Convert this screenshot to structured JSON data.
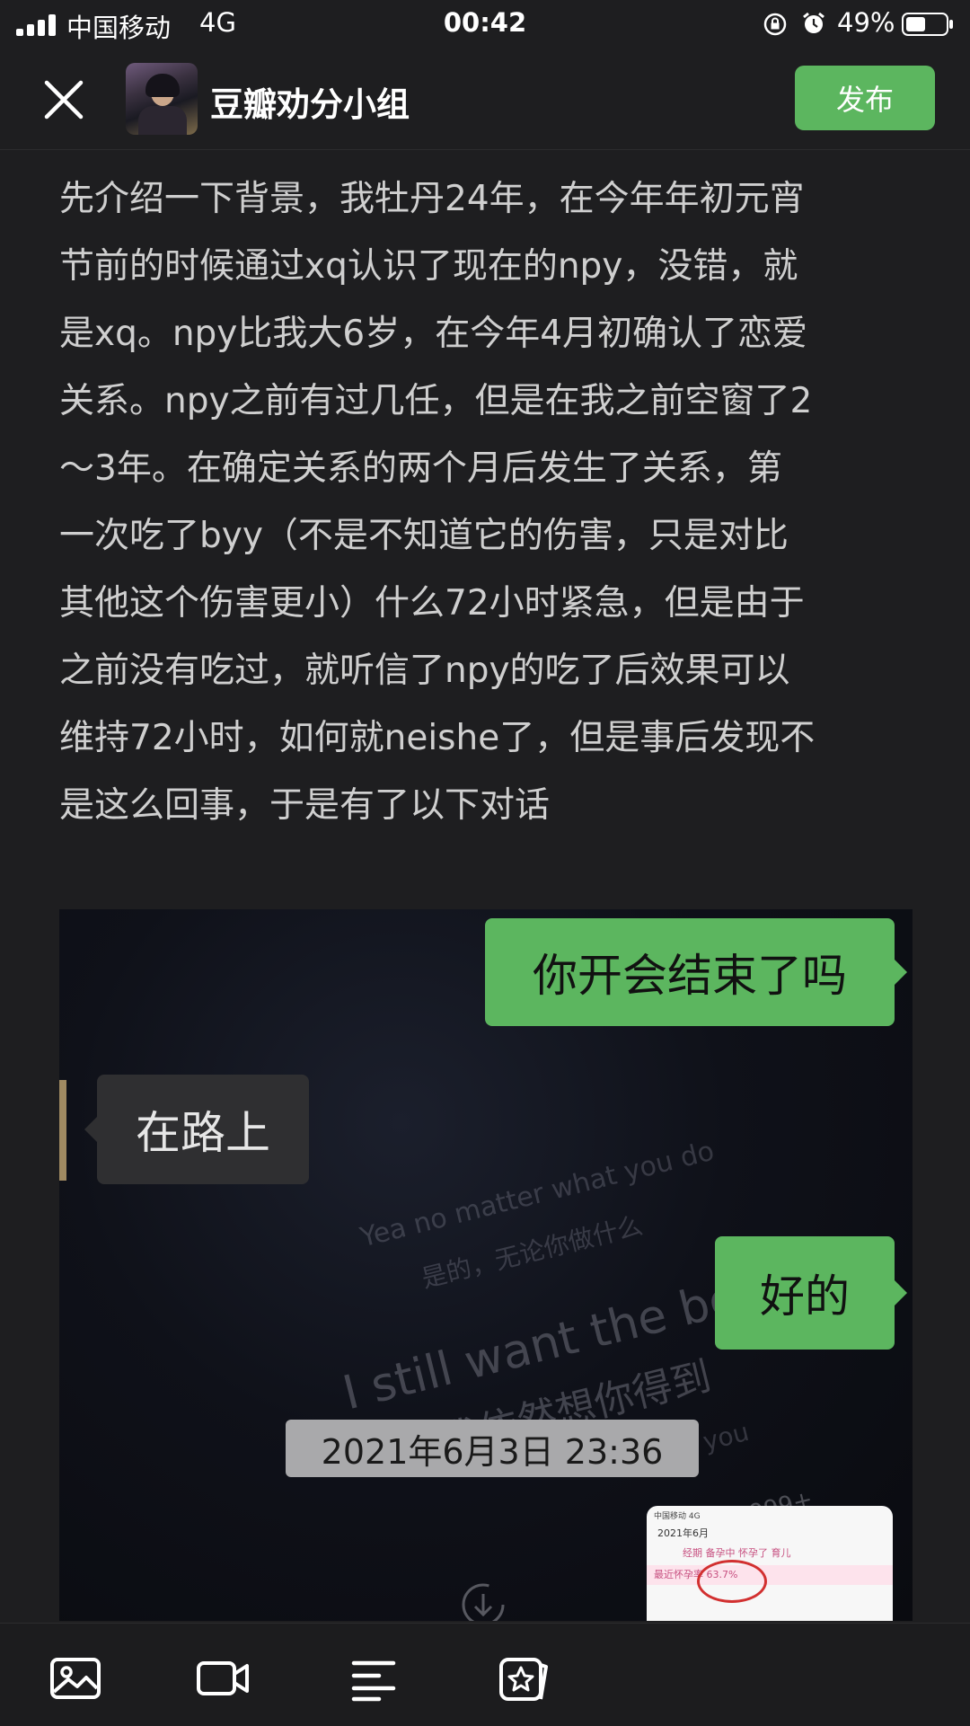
{
  "status_bar": {
    "carrier": "中国移动",
    "network": "4G",
    "time": "00:42",
    "battery_percent": "49%"
  },
  "header": {
    "group_name": "豆瓣劝分小组",
    "publish_label": "发布"
  },
  "post": {
    "body": "先介绍一下背景，我牡丹24年，在今年年初元宵\n节前的时候通过xq认识了现在的npy，没错，就\n是xq。npy比我大6岁，在今年4月初确认了恋爱\n关系。npy之前有过几任，但是在我之前空窗了2\n～3年。在确定关系的两个月后发生了关系，第\n一次吃了byy（不是不知道它的伤害，只是对比\n其他这个伤害更小）什么72小时紧急，但是由于\n之前没有吃过，就听信了npy的吃了后效果可以\n维持72小时，如何就neishe了，但是事后发现不\n是这么回事，于是有了以下对话"
  },
  "embedded_image": {
    "messages": [
      {
        "side": "right",
        "text": "你开会结束了吗"
      },
      {
        "side": "left",
        "text": "在路上"
      },
      {
        "side": "right",
        "text": "好的"
      }
    ],
    "timestamp": "2021年6月3日 23:36",
    "background_lyrics": [
      "Yea no matter what you do",
      "是的，无论你做什么",
      "I still want the best",
      "我依然想你得到",
      "what you"
    ],
    "count_badge": "999+",
    "thumbnail": {
      "status": "中国移动 4G",
      "title": "2021年6月",
      "tabs": "经期 备孕中 怀孕了 育儿",
      "row": "最近怀孕率 63.7%"
    }
  },
  "toolbar": {
    "items": [
      "image-icon",
      "video-icon",
      "text-format-icon",
      "sticker-icon"
    ]
  },
  "colors": {
    "accent_green": "#5cb65f",
    "background": "#1e1e20"
  }
}
